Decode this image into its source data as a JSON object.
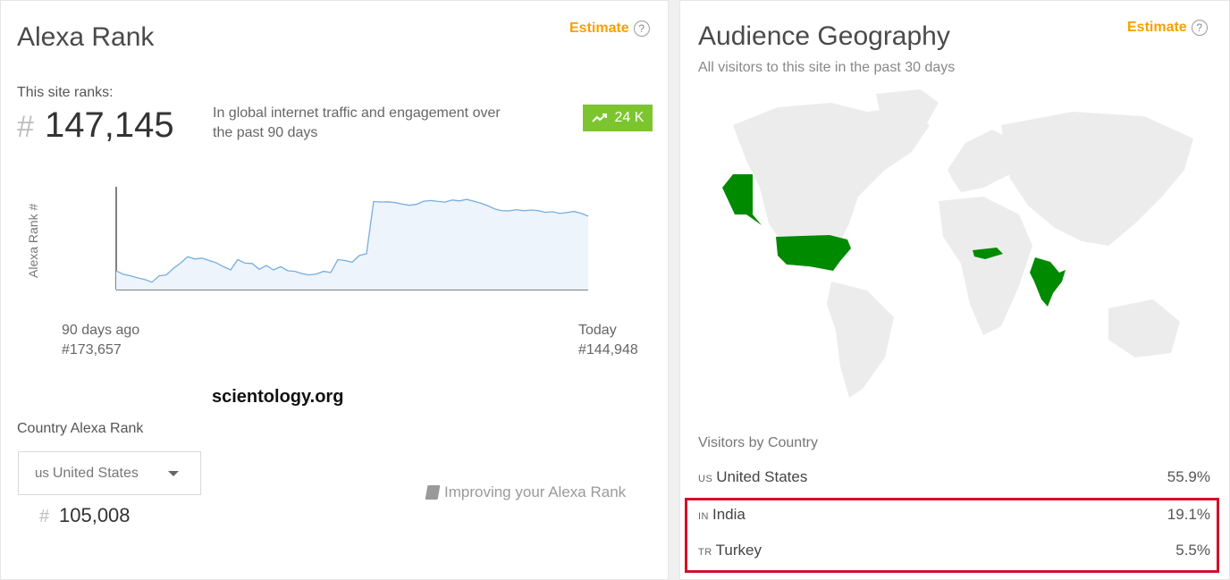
{
  "left": {
    "title": "Alexa Rank",
    "estimate_label": "Estimate",
    "help_glyph": "?",
    "site_ranks_label": "This site ranks:",
    "rank_hash": "#",
    "rank_value": "147,145",
    "rank_desc": "In global internet traffic and engagement over the past 90 days",
    "badge_value": "24 K",
    "badge_icon": "trending-up-icon",
    "badge_color": "#7dc52e",
    "domain_text": "scientology.org",
    "country_rank_label": "Country Alexa Rank",
    "country_selected_code": "us",
    "country_selected_name": "United States",
    "country_rank_value": "105,008",
    "improve_label": "Improving your Alexa Rank"
  },
  "chart_data": {
    "type": "area",
    "ylabel": "Alexa Rank #",
    "start_label": "90 days ago",
    "start_value": "#173,657",
    "end_label": "Today",
    "end_value": "#144,948",
    "y_inverted": true,
    "series": [
      {
        "values": [
          173657,
          174800,
          175300,
          176000,
          176600,
          177500,
          175300,
          175000,
          172800,
          171000,
          168800,
          169600,
          169300,
          170100,
          170900,
          172200,
          173300,
          169800,
          171000,
          171100,
          173100,
          171800,
          173300,
          172200,
          173600,
          173800,
          174600,
          175000,
          174700,
          173800,
          174200,
          169800,
          170100,
          170700,
          168400,
          167800,
          150000,
          150200,
          150100,
          150400,
          150900,
          151300,
          151000,
          149900,
          149700,
          150000,
          150200,
          149500,
          149800,
          149300,
          149900,
          150600,
          151500,
          152600,
          153200,
          153200,
          152800,
          153200,
          152900,
          153100,
          153700,
          153500,
          154100,
          153800,
          153400,
          154000,
          155000
        ]
      }
    ],
    "color": "#77aee0",
    "fill": "#eef4fc"
  },
  "right": {
    "title": "Audience Geography",
    "estimate_label": "Estimate",
    "help_glyph": "?",
    "subtitle": "All visitors to this site in the past 30 days",
    "map_highlight_color": "#008a00",
    "map_base_color": "#ececec",
    "visitors_label": "Visitors by Country",
    "countries": [
      {
        "code": "us",
        "name": "United States",
        "pct": "55.9%"
      },
      {
        "code": "in",
        "name": "India",
        "pct": "19.1%"
      },
      {
        "code": "tr",
        "name": "Turkey",
        "pct": "5.5%"
      }
    ],
    "highlight_box_color": "#d0102b"
  }
}
